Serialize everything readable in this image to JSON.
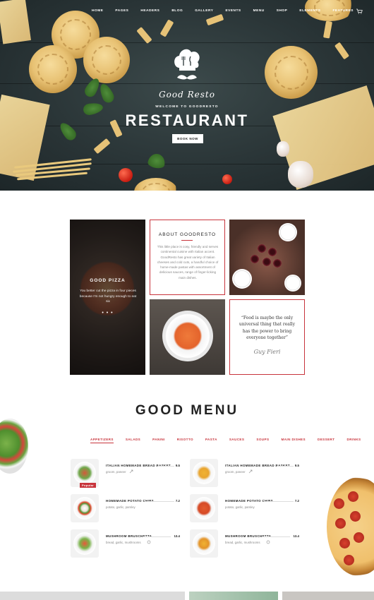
{
  "nav": {
    "items": [
      "HOME",
      "PAGES",
      "HEADERS",
      "BLOG",
      "GALLERY",
      "EVENTS",
      "MENU",
      "SHOP",
      "ELEMENTS",
      "FEATURES"
    ],
    "cart_icon": "cart-icon"
  },
  "hero": {
    "logo_text": "Good Resto",
    "welcome": "WELCOME TO GOODRESTO",
    "title": "RESTAURANT",
    "button": "BOOK NOW"
  },
  "pizza_panel": {
    "title": "GOOD PIZZA",
    "text": "You better cut the pizza in four pieces because I'm not hungry enough to eat six",
    "dots": "• • •"
  },
  "about": {
    "title": "ABOUT GOODRESTO",
    "text": "This little place is cosy, friendly and serves continental cuisine with Italian accent. GoodResto has great variety of Italian cheeses and cold cuts, a handful choice of home-made pastas with assortment of delicious sauces, range of finger-licking main dishes."
  },
  "quote": {
    "text": "“Food is maybe the only universal thing that really has the power to bring everyone together”",
    "author": "Guy Fieri"
  },
  "menu": {
    "title": "GOOD MENU",
    "tabs": [
      "APPETIZERS",
      "SALADS",
      "PANINI",
      "RISOTTO",
      "PASTA",
      "SAUCES",
      "SOUPS",
      "MAIN DISHES",
      "DESSERT",
      "DRINKS"
    ],
    "active_tab": "APPETIZERS",
    "badge": "Popular",
    "left": [
      {
        "name": "ITALIAN HOMEMADE BREAD BASKET",
        "price": "9.5",
        "ingredients": "groom, paneer"
      },
      {
        "name": "HOMEMADE POTATO CHIPS",
        "price": "7.2",
        "ingredients": "potato, garlic, parsley"
      },
      {
        "name": "MUSHROOM BRUSCHETTA",
        "price": "13.4",
        "ingredients": "bread, garlic, mushrooms"
      }
    ],
    "right": [
      {
        "name": "ITALIAN HOMEMADE BREAD BASKET",
        "price": "9.5",
        "ingredients": "groom, paneer"
      },
      {
        "name": "HOMEMADE POTATO CHIPS",
        "price": "7.2",
        "ingredients": "potato, garlic, parsley"
      },
      {
        "name": "MUSHROOM BRUSCHETTA",
        "price": "13.4",
        "ingredients": "bread, garlic, mushrooms"
      }
    ]
  },
  "colors": {
    "accent": "#c8343c",
    "hero_bg": "#2a3537"
  }
}
